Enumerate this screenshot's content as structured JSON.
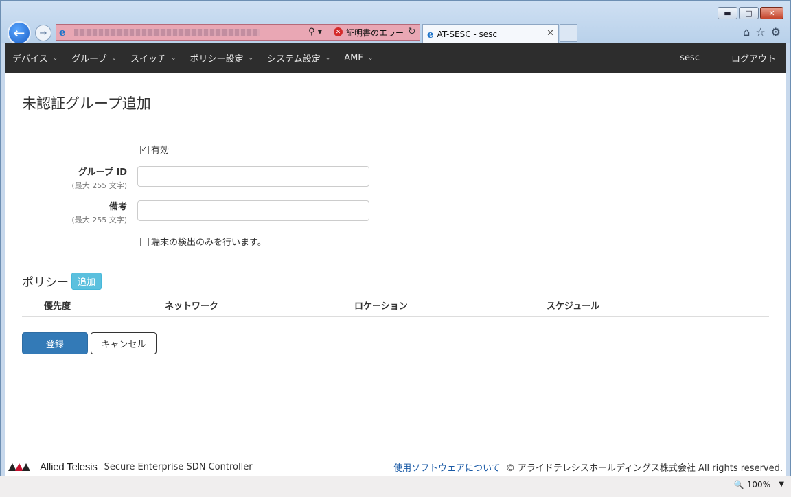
{
  "browser": {
    "tab_title": "AT-SESC - sesc",
    "cert_error": "証明書のエラー",
    "zoom": "100%"
  },
  "nav": {
    "items": [
      {
        "label": "デバイス"
      },
      {
        "label": "グループ"
      },
      {
        "label": "スイッチ"
      },
      {
        "label": "ポリシー設定"
      },
      {
        "label": "システム設定"
      },
      {
        "label": "AMF"
      }
    ],
    "user": "sesc",
    "logout": "ログアウト"
  },
  "page": {
    "title": "未認証グループ追加",
    "enabled_label": "有効",
    "group_id_label": "グループ ID",
    "group_id_hint": "(最大 255 文字)",
    "group_id_value": "",
    "note_label": "備考",
    "note_hint": "(最大 255 文字)",
    "note_value": "",
    "detect_only_label": "端末の検出のみを行います。",
    "policy_heading": "ポリシー",
    "policy_add": "追加",
    "columns": [
      "優先度",
      "ネットワーク",
      "ロケーション",
      "スケジュール"
    ],
    "submit": "登録",
    "cancel": "キャンセル"
  },
  "footer": {
    "brand": "Allied Telesis",
    "product": "Secure Enterprise SDN Controller",
    "software_link": "使用ソフトウェアについて",
    "copyright": "© アライドテレシスホールディングス株式会社 All rights reserved."
  }
}
